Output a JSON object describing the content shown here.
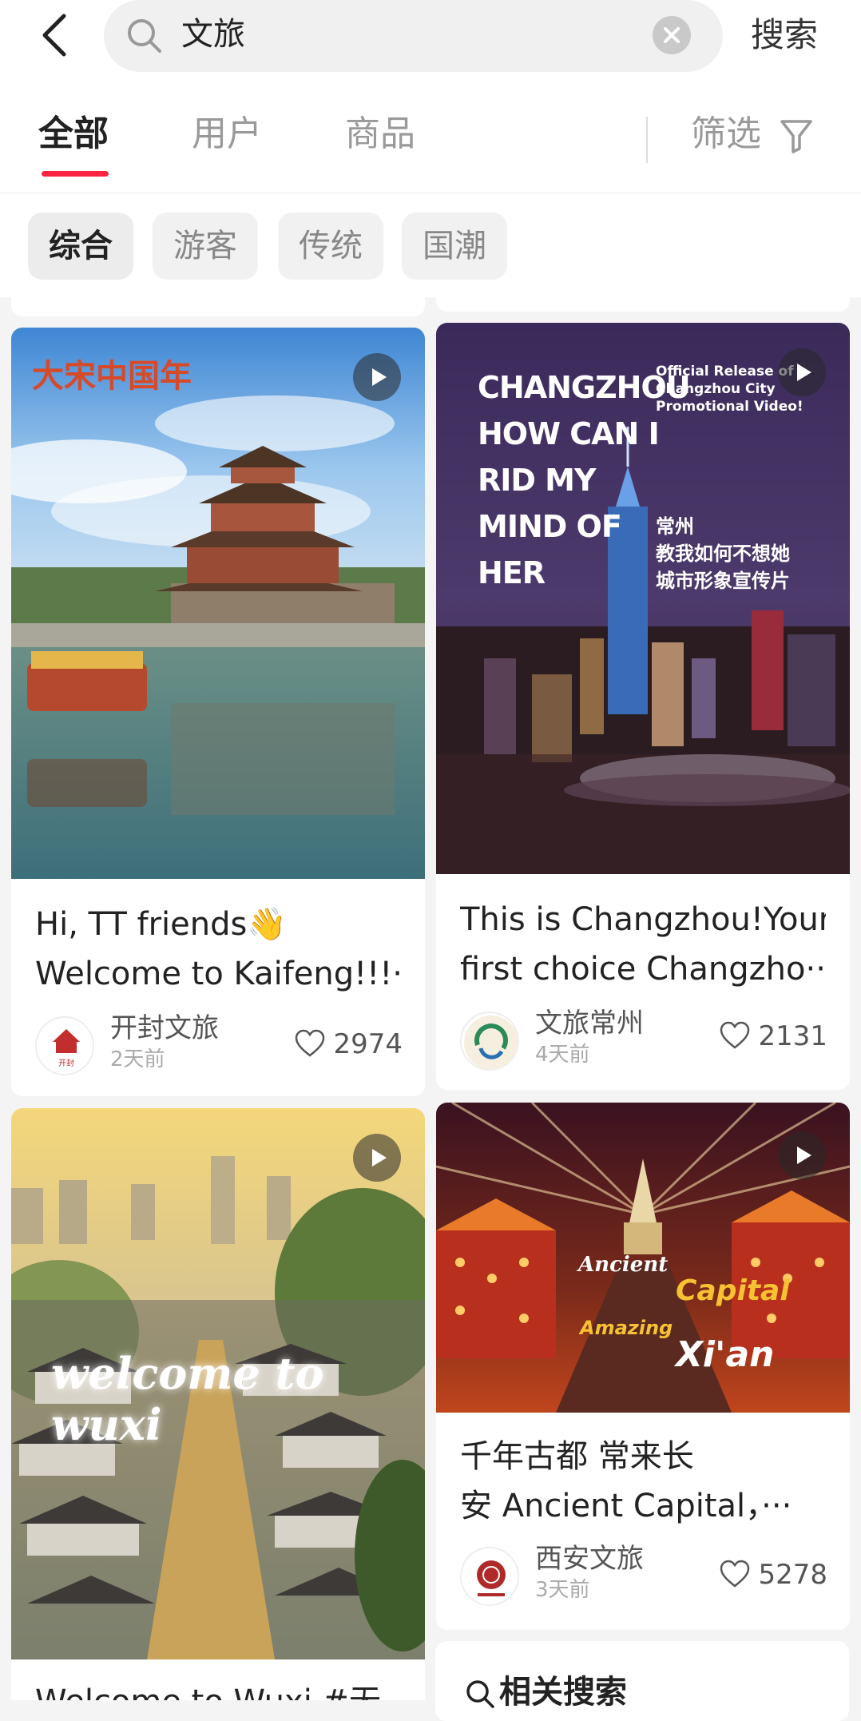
{
  "search": {
    "query": "文旅",
    "button_label": "搜索"
  },
  "tabs": [
    {
      "label": "全部",
      "active": true
    },
    {
      "label": "用户",
      "active": false
    },
    {
      "label": "商品",
      "active": false
    }
  ],
  "filter_label": "筛选",
  "chips": [
    {
      "label": "综合",
      "active": true
    },
    {
      "label": "游客",
      "active": false
    },
    {
      "label": "传统",
      "active": false
    },
    {
      "label": "国潮",
      "active": false
    }
  ],
  "cards": [
    {
      "title_line1": "Hi, TT friends👋",
      "title_line2": "Welcome to Kaifeng!!!···",
      "author": "开封文旅",
      "time": "2天前",
      "likes": "2974",
      "overlay": "大宋中国年",
      "avatar_text": "开封"
    },
    {
      "title_line1": "This is Changzhou!Your",
      "title_line2": "first choice Changzho···",
      "author": "文旅常州",
      "time": "4天前",
      "likes": "2131",
      "overlay_en": "CHANGZHOU HOW CAN I RID MY MIND OF HER",
      "overlay_lines": [
        "CHANGZHOU",
        "HOW CAN I",
        "RID MY",
        "MIND OF",
        "HER"
      ],
      "overlay_side_en": [
        "Official Release of",
        "Changzhou City",
        "Promotional Video!"
      ],
      "overlay_cn": [
        "常州",
        "教我如何不想她",
        "城市形象宣传片"
      ]
    },
    {
      "title_line1": "Welcome to Wuxi   #无",
      "overlay": "welcome to wuxi"
    },
    {
      "title_line1": "千年古都 常来长",
      "title_line2": "安 Ancient Capital，···",
      "author": "西安文旅",
      "time": "3天前",
      "likes": "5278",
      "overlay_words": [
        "Ancient",
        "Capital",
        "Amazing",
        "Xi'an"
      ]
    }
  ],
  "related_search_label": "相关搜索",
  "colors": {
    "accent": "#ff2442",
    "muted": "#999999",
    "background": "#f4f4f4"
  }
}
